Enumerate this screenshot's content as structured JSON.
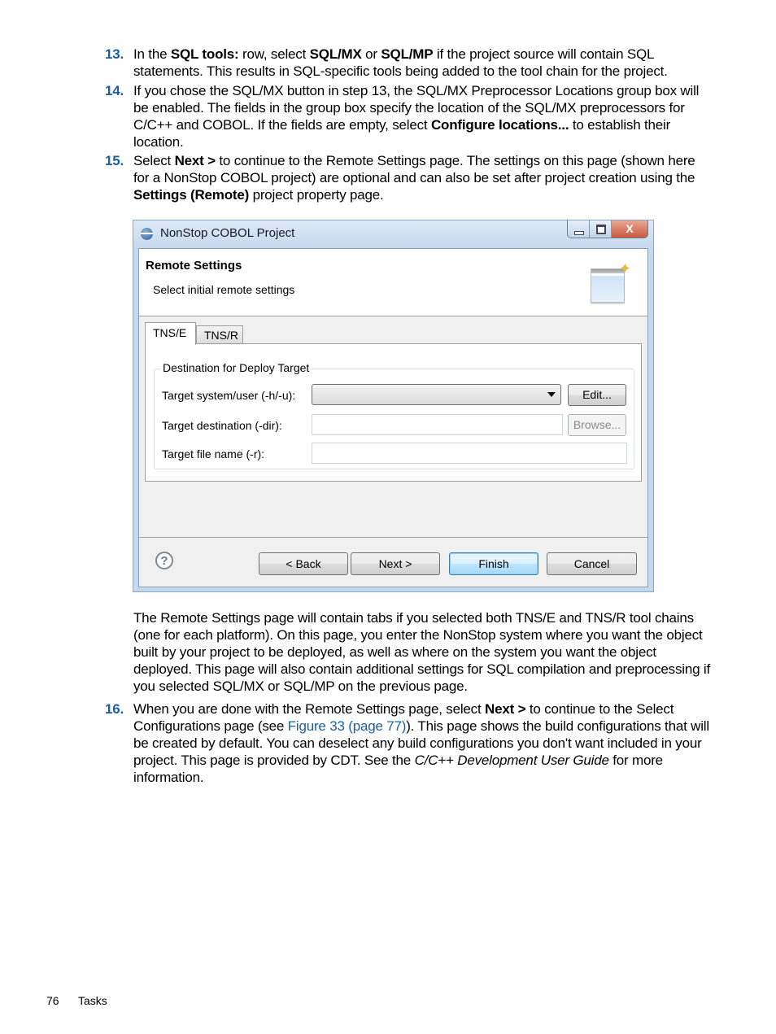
{
  "steps": {
    "s13": {
      "number": "13.",
      "parts": [
        "In the ",
        "SQL tools:",
        " row, select ",
        "SQL/MX",
        " or ",
        "SQL/MP",
        " if the project source will contain SQL statements. This results in SQL-specific tools being added to the tool chain for the project."
      ]
    },
    "s14": {
      "number": "14.",
      "parts": [
        "If you chose the SQL/MX button in step 13, the SQL/MX Preprocessor Locations group box will be enabled. The fields in the group box specify the location of the SQL/MX preprocessors for C/C++ and COBOL. If the fields are empty, select ",
        "Configure locations...",
        " to establish their location."
      ]
    },
    "s15": {
      "number": "15.",
      "parts": [
        "Select ",
        "Next >",
        " to continue to the Remote Settings page. The settings on this page (shown here for a NonStop COBOL project) are optional and can also be set after project creation using the ",
        "Settings (Remote)",
        " project property page."
      ]
    },
    "after_figure": "The Remote Settings page will contain tabs if you selected both TNS/E and TNS/R tool chains (one for each platform). On this page, you enter the NonStop system where you want the object built by your project to be deployed, as well as where on the system you want the object deployed. This page will also contain additional settings for SQL compilation and preprocessing if you selected SQL/MX or SQL/MP on the previous page.",
    "s16": {
      "number": "16.",
      "parts": [
        "When you are done with the Remote Settings page, select ",
        "Next >",
        " to continue to the Select Configurations page (see ",
        "Figure 33 (page 77)",
        "). This page shows the build configurations that will be created by default. You can deselect any build configurations you don't want included in your project. This page is provided by CDT. See the ",
        "C/C++ Development User Guide",
        " for more information."
      ]
    }
  },
  "dialog": {
    "title": "NonStop COBOL Project",
    "window_buttons": {
      "minimize": "minimize-icon",
      "maximize": "maximize-icon",
      "close": "X"
    },
    "banner_title": "Remote Settings",
    "banner_description": "Select initial remote settings",
    "banner_icon": "wizard-icon",
    "tabs": [
      {
        "label": "TNS/E",
        "active": true
      },
      {
        "label": "TNS/R",
        "active": false
      }
    ],
    "group_title": "Destination for Deploy Target",
    "rows": [
      {
        "label": "Target system/user (-h/-u):",
        "value": "",
        "button": "Edit...",
        "button_enabled": true
      },
      {
        "label": "Target destination (-dir):",
        "value": "",
        "button": "Browse...",
        "button_enabled": false
      },
      {
        "label": "Target file name (-r):",
        "value": ""
      }
    ],
    "buttons": {
      "back": "< Back",
      "next": "Next >",
      "finish": "Finish",
      "cancel": "Cancel"
    },
    "help_icon": "?"
  },
  "footer": {
    "page_number": "76",
    "section": "Tasks"
  },
  "colors": {
    "step_number": "#1d5f9e",
    "link": "#1d5f9e"
  }
}
